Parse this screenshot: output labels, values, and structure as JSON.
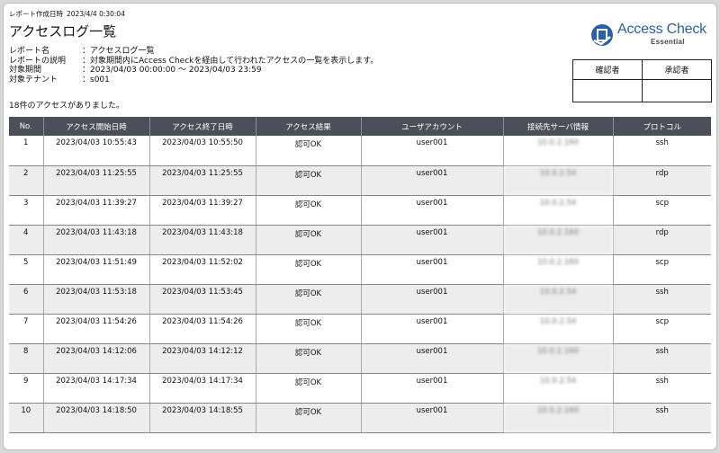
{
  "report": {
    "created_label": "レポート作成日時",
    "created_value": "2023/4/4 0:30:04",
    "title": "アクセスログ一覧",
    "meta": [
      {
        "label": "レポート名",
        "value": "：アクセスログ一覧"
      },
      {
        "label": "レポートの説明",
        "value": "：対象期間内にAccess Checkを経由して行われたアクセスの一覧を表示します。"
      },
      {
        "label": "対象期間",
        "value": "：2023/04/03 00:00:00 〜 2023/04/03 23:59"
      },
      {
        "label": "対象テナント",
        "value": "：s001"
      }
    ],
    "count_text": "18件のアクセスがありました。"
  },
  "logo": {
    "name": "Access Check",
    "edition": "Essential",
    "color": "#2b5fa8"
  },
  "approval": {
    "checker": "確認者",
    "approver": "承認者"
  },
  "table": {
    "headers": [
      "No.",
      "アクセス開始日時",
      "アクセス終了日時",
      "アクセス結果",
      "ユーザアカウント",
      "接続先サーバ情報",
      "プロトコル"
    ],
    "rows": [
      [
        "1",
        "2023/04/03 10:55:43",
        "2023/04/03 10:55:50",
        "認可OK",
        "user001",
        "10.0.2.160",
        "ssh"
      ],
      [
        "2",
        "2023/04/03 11:25:55",
        "2023/04/03 11:25:55",
        "認可OK",
        "user001",
        "10.0.2.54",
        "rdp"
      ],
      [
        "3",
        "2023/04/03 11:39:27",
        "2023/04/03 11:39:27",
        "認可OK",
        "user001",
        "10.0.2.54",
        "scp"
      ],
      [
        "4",
        "2023/04/03 11:43:18",
        "2023/04/03 11:43:18",
        "認可OK",
        "user001",
        "10.0.2.160",
        "rdp"
      ],
      [
        "5",
        "2023/04/03 11:51:49",
        "2023/04/03 11:52:02",
        "認可OK",
        "user001",
        "10.0.2.160",
        "scp"
      ],
      [
        "6",
        "2023/04/03 11:53:18",
        "2023/04/03 11:53:45",
        "認可OK",
        "user001",
        "10.0.2.54",
        "ssh"
      ],
      [
        "7",
        "2023/04/03 11:54:26",
        "2023/04/03 11:54:26",
        "認可OK",
        "user001",
        "10.0.2.54",
        "scp"
      ],
      [
        "8",
        "2023/04/03 14:12:06",
        "2023/04/03 14:12:12",
        "認可OK",
        "user001",
        "10.0.2.160",
        "ssh"
      ],
      [
        "9",
        "2023/04/03 14:17:34",
        "2023/04/03 14:17:34",
        "認可OK",
        "user001",
        "10.0.2.54",
        "ssh"
      ],
      [
        "10",
        "2023/04/03 14:18:50",
        "2023/04/03 14:18:55",
        "認可OK",
        "user001",
        "10.0.2.160",
        "ssh"
      ]
    ]
  }
}
